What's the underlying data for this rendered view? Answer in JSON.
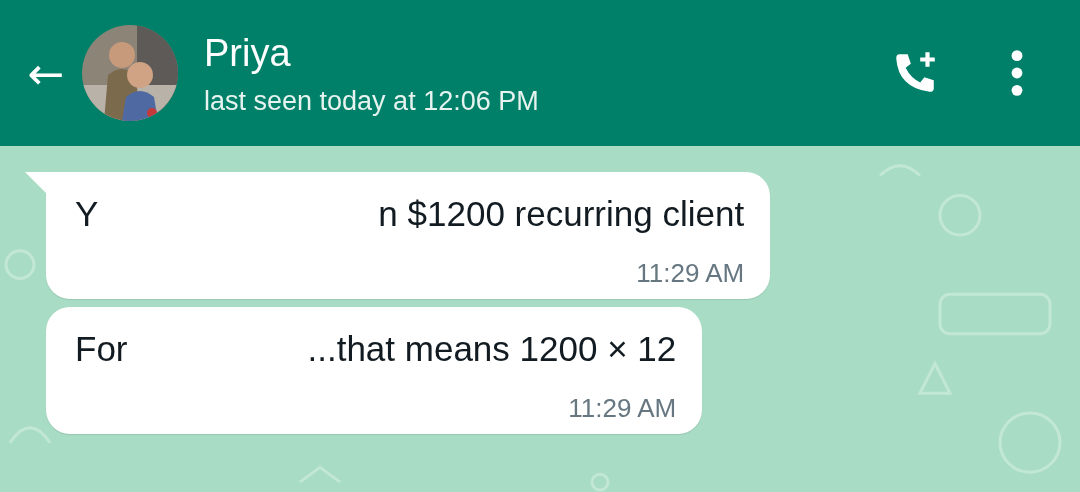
{
  "header": {
    "back": "←",
    "name": "Priya",
    "status": "last seen today at 12:06 PM"
  },
  "messages": [
    {
      "parts": [
        "Y",
        "n $1200 recurring client"
      ],
      "time": "11:29 AM",
      "tail": true
    },
    {
      "parts": [
        "For",
        "...that means 1200 × 12"
      ],
      "time": "11:29 AM",
      "tail": false
    }
  ]
}
